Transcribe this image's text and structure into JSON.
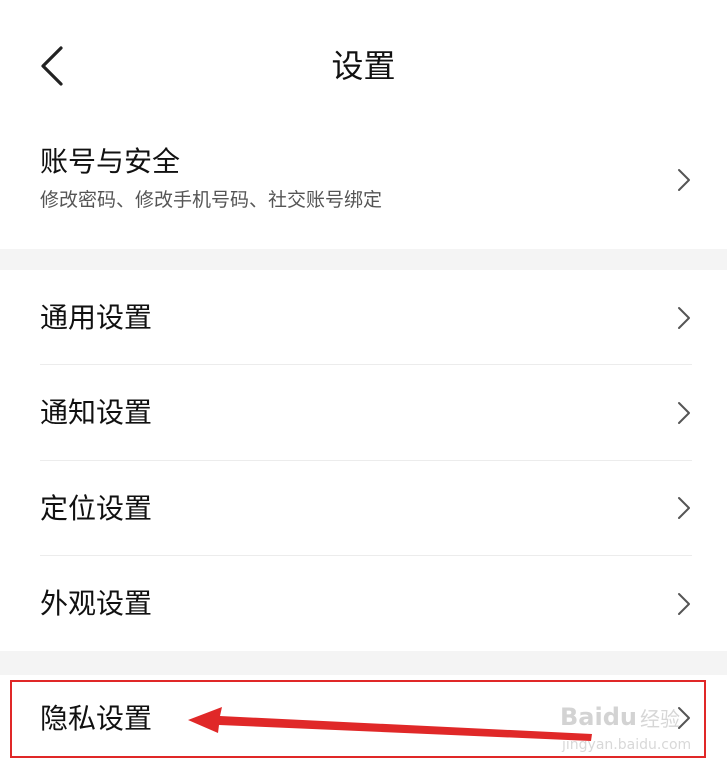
{
  "header": {
    "title": "设置",
    "back_icon": "chevron-left-icon"
  },
  "account": {
    "title": "账号与安全",
    "subtitle": "修改密码、修改手机号码、社交账号绑定",
    "chevron_icon": "chevron-right-icon"
  },
  "settings": {
    "items": [
      {
        "label": "通用设置"
      },
      {
        "label": "通知设置"
      },
      {
        "label": "定位设置"
      },
      {
        "label": "外观设置"
      }
    ]
  },
  "privacy": {
    "label": "隐私设置"
  },
  "annotation": {
    "highlight_color": "#e02828",
    "arrow_color": "#e02828"
  },
  "watermark": {
    "brand": "Baidu",
    "product": "经验",
    "url": "jingyan.baidu.com"
  }
}
